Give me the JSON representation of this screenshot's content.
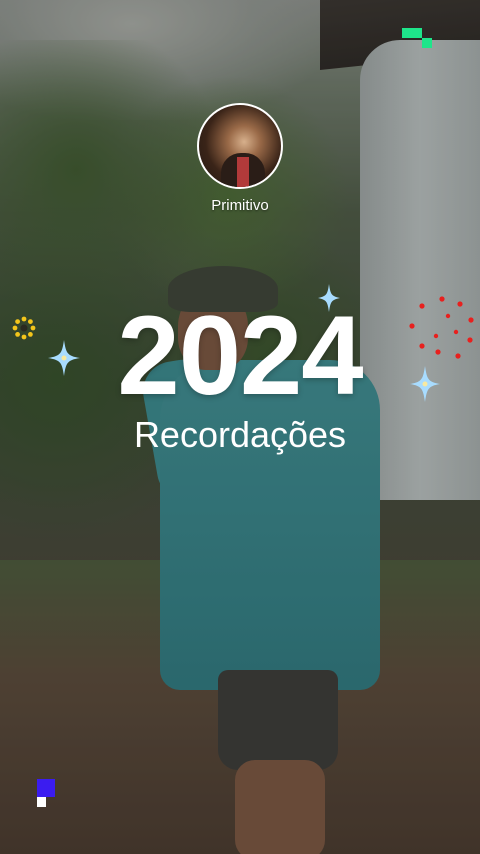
{
  "profile": {
    "username": "Primitivo"
  },
  "recap": {
    "year": "2024",
    "subtitle": "Recordações"
  },
  "colors": {
    "text": "#ffffff",
    "sparkle": "#9fd8ff",
    "flower": "#f3c51b",
    "firework": "#e8201e",
    "pixel_green": "#1ee58a",
    "pixel_blue": "#3b1cf0"
  },
  "icons": [
    "sparkle-icon",
    "flower-icon",
    "firework-icon",
    "pixel-decoration"
  ]
}
